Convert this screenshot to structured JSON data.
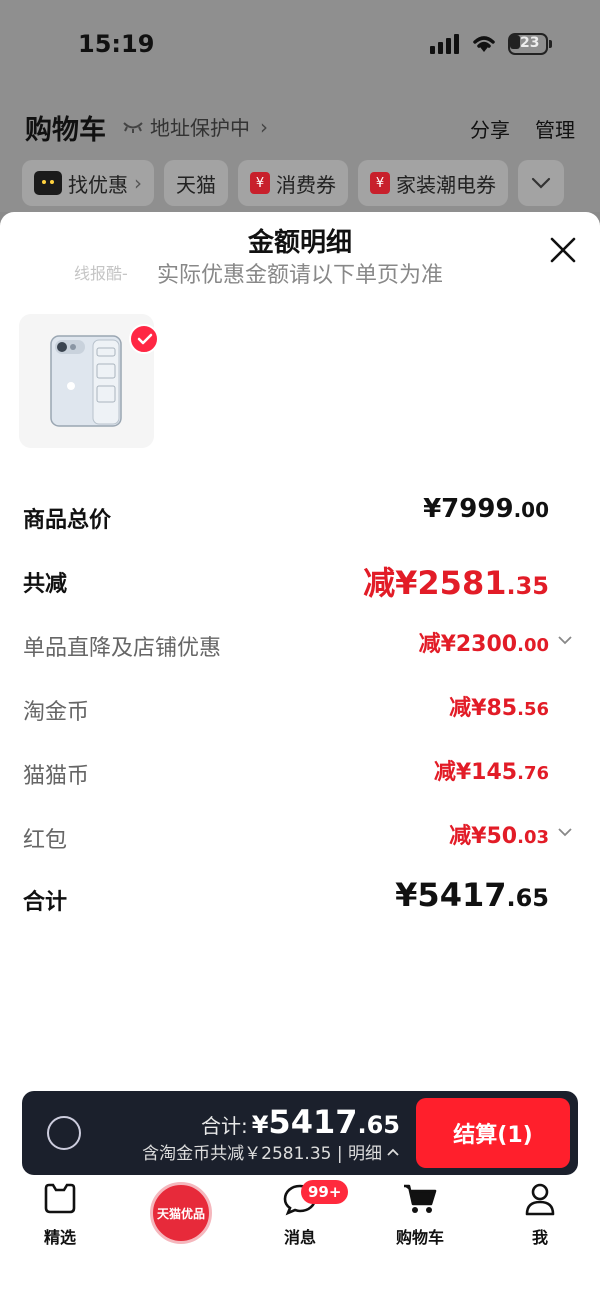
{
  "status_bar": {
    "time": "15:19",
    "battery": "23"
  },
  "header": {
    "title": "购物车",
    "address_protect": "地址保护中",
    "share": "分享",
    "manage": "管理"
  },
  "filter_chips": [
    {
      "label": "找优惠"
    },
    {
      "label": "天猫"
    },
    {
      "label": "消费券"
    },
    {
      "label": "家装潮电券"
    }
  ],
  "sheet": {
    "title": "金额明细",
    "subtitle": "实际优惠金额请以下单页为准",
    "watermark": "线报酷-"
  },
  "price_rows": [
    {
      "label": "商品总价",
      "main": "¥7999",
      "cents": ".00"
    },
    {
      "label": "共减",
      "main": "减¥2581",
      "cents": ".35"
    },
    {
      "label": "单品直降及店铺优惠",
      "main": "减¥2300",
      "cents": ".00"
    },
    {
      "label": "淘金币",
      "main": "减¥85",
      "cents": ".56"
    },
    {
      "label": "猫猫币",
      "main": "减¥145",
      "cents": ".76"
    },
    {
      "label": "红包",
      "main": "减¥50",
      "cents": ".03"
    },
    {
      "label": "合计",
      "main": "¥5417",
      "cents": ".65"
    }
  ],
  "checkout": {
    "total_label": "合计:",
    "yen": "¥",
    "total_main": "5417",
    "total_cents": ".65",
    "discount_text": "含淘金币共减￥2581.35 | 明细",
    "button": "结算(1)"
  },
  "tabbar": {
    "home": "精选",
    "tmall": "天猫优品",
    "messages": "消息",
    "messages_badge": "99+",
    "cart": "购物车",
    "me": "我"
  },
  "colors": {
    "accent_red": "#e21c27",
    "button_red": "#ff1f2c",
    "bar_dark": "#1b202c"
  }
}
